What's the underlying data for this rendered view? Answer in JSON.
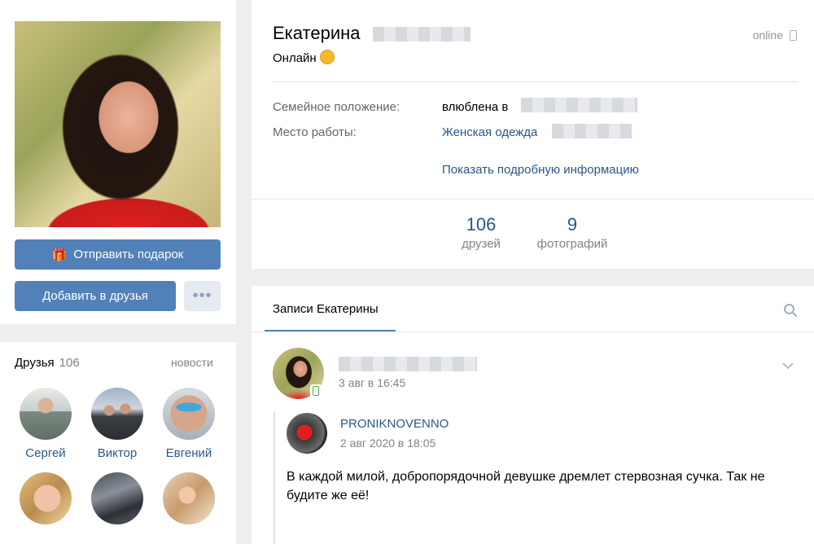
{
  "sidebar": {
    "gift_button": "Отправить подарок",
    "add_friend_button": "Добавить в друзья",
    "more_button": "•••"
  },
  "friends": {
    "title": "Друзья",
    "count": "106",
    "news_link": "новости",
    "items": [
      {
        "name": "Сергей"
      },
      {
        "name": "Виктор"
      },
      {
        "name": "Евгений"
      },
      {
        "name": ""
      },
      {
        "name": ""
      },
      {
        "name": ""
      }
    ]
  },
  "profile": {
    "first_name": "Екатерина",
    "status": "Онлайн",
    "online_label": "online",
    "info": [
      {
        "label": "Семейное положение:",
        "value": "влюблена в"
      },
      {
        "label": "Место работы:",
        "value": "Женская одежда"
      }
    ],
    "details_link": "Показать подробную информацию",
    "counters": [
      {
        "value": "106",
        "label": "друзей"
      },
      {
        "value": "9",
        "label": "фотографий"
      }
    ]
  },
  "wall": {
    "tab_label": "Записи Екатерины",
    "post": {
      "date": "3 авг в 16:45",
      "repost": {
        "author": "PRONIKNOVENNO",
        "date": "2 авг 2020 в 18:05",
        "text": "В каждой милой, добропорядочной девушке дремлет стервозная сучка. Так не будите же её!"
      }
    }
  },
  "colors": {
    "accent": "#5181b8",
    "link": "#2a5885",
    "background": "#edeef0"
  },
  "icons": [
    "gift-icon",
    "mobile-icon",
    "search-icon",
    "chevron-down-icon",
    "smile-emoji-icon"
  ]
}
